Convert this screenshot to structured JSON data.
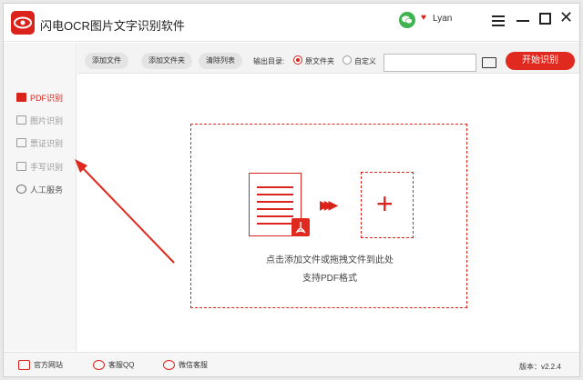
{
  "window": {
    "title": "闪电OCR图片文字识别软件",
    "user_name": "Lyan"
  },
  "sidebar": {
    "items": [
      {
        "label": "PDF识别",
        "icon": "pdf-icon",
        "active": true
      },
      {
        "label": "图片识别",
        "icon": "image-icon",
        "active": false
      },
      {
        "label": "票证识别",
        "icon": "ticket-icon",
        "active": false
      },
      {
        "label": "手写识别",
        "icon": "handwriting-icon",
        "active": false
      },
      {
        "label": "人工服务",
        "icon": "smiley-icon",
        "active": false
      }
    ]
  },
  "toolbar": {
    "add_file": "添加文件",
    "add_folder": "添加文件夹",
    "clear_list": "清除列表",
    "output_label": "输出目录:",
    "radio_source": "原文件夹",
    "radio_custom": "自定义",
    "path_value": "",
    "start_label": "开始识别"
  },
  "main": {
    "hint_line1": "点击添加文件或拖拽文件到此处",
    "hint_line2": "支持PDF格式",
    "plus": "+",
    "pdf_badge_icon": "pdf-logo-icon"
  },
  "footer": {
    "website": "官方网站",
    "qq_service": "客服QQ",
    "wechat_service": "微信客服",
    "version": "版本：v2.2.4"
  },
  "colors": {
    "accent": "#e02a20",
    "wechat": "#3fb34f"
  }
}
